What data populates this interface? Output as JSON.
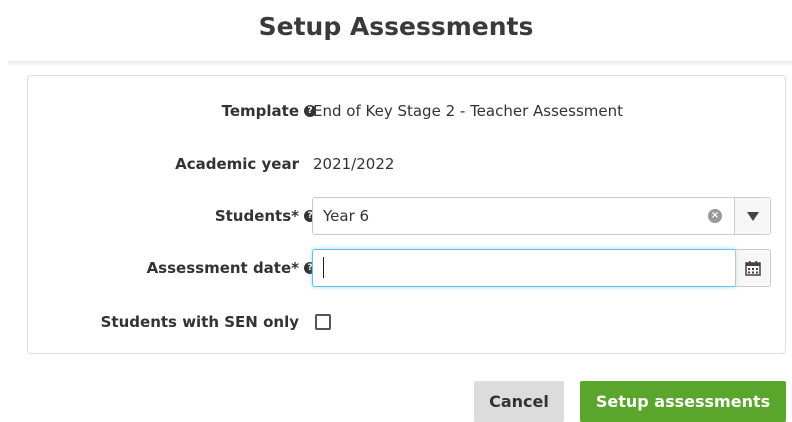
{
  "page": {
    "title": "Setup Assessments"
  },
  "form": {
    "template": {
      "label": "Template",
      "value": "End of Key Stage 2 - Teacher Assessment"
    },
    "academic_year": {
      "label": "Academic year",
      "value": "2021/2022"
    },
    "students": {
      "label": "Students*",
      "value": "Year 6"
    },
    "assessment_date": {
      "label": "Assessment date*",
      "value": ""
    },
    "sen_only": {
      "label": "Students with SEN only",
      "checked": false
    }
  },
  "actions": {
    "cancel_label": "Cancel",
    "setup_label": "Setup assessments"
  },
  "colors": {
    "primary": "#5aa52c",
    "focus": "#66c3e8",
    "cancel": "#dcdcdc"
  },
  "icons": {
    "help": "question-circle-icon",
    "clear": "clear-icon",
    "dropdown": "caret-down-icon",
    "calendar": "calendar-icon"
  }
}
